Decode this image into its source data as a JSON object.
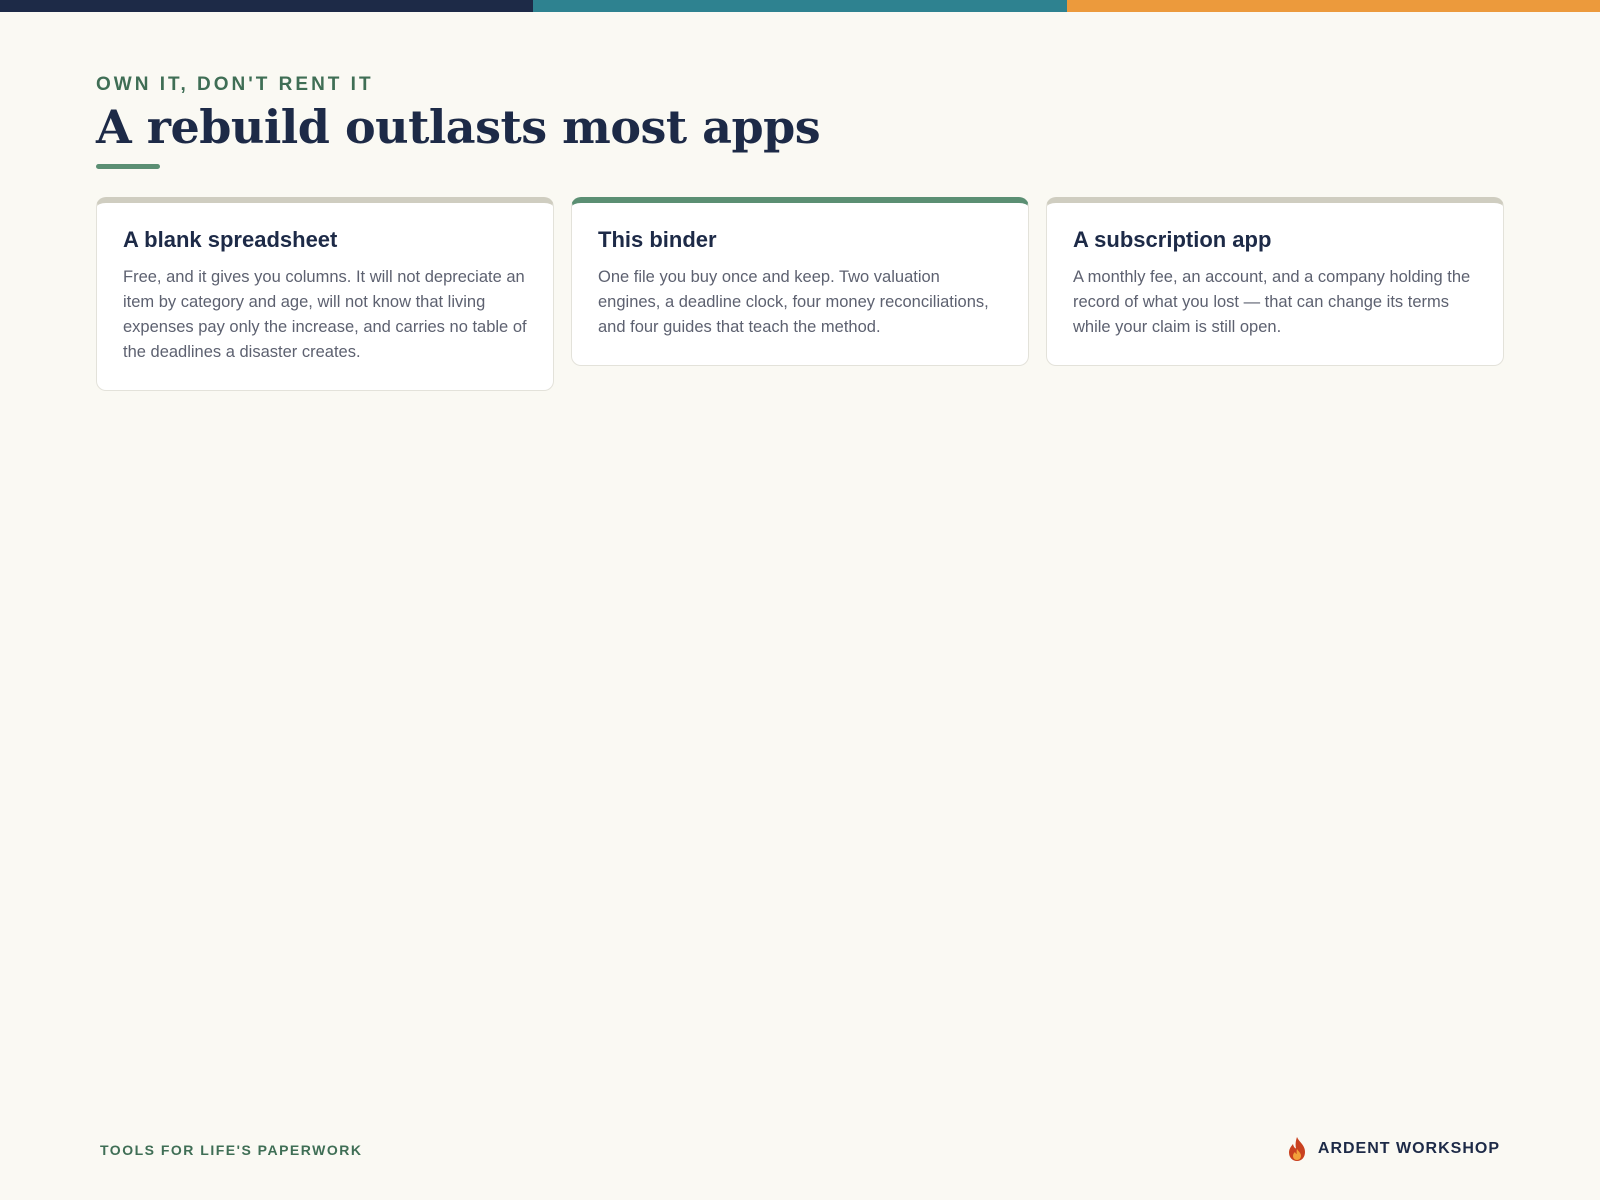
{
  "colors": {
    "band_navy": "#1d2a47",
    "band_teal": "#2e8290",
    "band_orange": "#ec9a3c",
    "accent_green": "#5b8f73",
    "text_dark": "#1d2a47",
    "text_muted": "#5d6170",
    "page_bg": "#faf9f3"
  },
  "header": {
    "eyebrow": "OWN IT, DON'T RENT IT",
    "title": "A rebuild outlasts most apps"
  },
  "cards": [
    {
      "title": "A blank spreadsheet",
      "body": "Free, and it gives you columns. It will not depreciate an item by category and age, will not know that living expenses pay only the increase, and carries no table of the deadlines a disaster creates.",
      "highlighted": false
    },
    {
      "title": "This binder",
      "body": "One file you buy once and keep. Two valuation engines, a deadline clock, four money reconciliations, and four guides that teach the method.",
      "highlighted": true
    },
    {
      "title": "A subscription app",
      "body": "A monthly fee, an account, and a company holding the record of what you lost — that can change its terms while your claim is still open.",
      "highlighted": false
    }
  ],
  "footer": {
    "tagline": "TOOLS FOR LIFE'S PAPERWORK",
    "brand": "ARDENT WORKSHOP",
    "brand_icon": "flame-icon"
  }
}
